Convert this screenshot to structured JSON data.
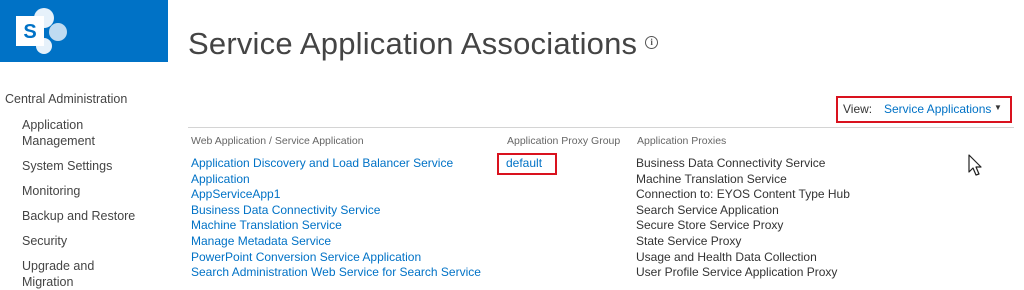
{
  "header": {
    "logo_letter": "S",
    "page_title": "Service Application Associations",
    "info_glyph": "i"
  },
  "leftnav": {
    "root": "Central Administration",
    "items": [
      "Application Management",
      "System Settings",
      "Monitoring",
      "Backup and Restore",
      "Security",
      "Upgrade and Migration"
    ]
  },
  "view": {
    "label": "View:",
    "selected": "Service Applications",
    "caret": "▼"
  },
  "table": {
    "columns": [
      "Web Application / Service Application",
      "Application Proxy Group",
      "Application Proxies"
    ],
    "applications": [
      "Application Discovery and Load Balancer Service",
      "Application",
      "AppServiceApp1",
      "Business Data Connectivity Service",
      "Machine Translation Service",
      "Manage Metadata Service",
      "PowerPoint Conversion Service Application",
      "Search Administration Web Service for Search Service"
    ],
    "proxy_group": "default",
    "proxies": [
      "Business Data Connectivity Service",
      "Machine Translation Service",
      "Connection to: EYOS Content Type Hub",
      "Search Service Application",
      "Secure Store Service Proxy",
      "State Service Proxy",
      "Usage and Health Data Collection",
      "User Profile Service Application Proxy"
    ]
  },
  "colors": {
    "brand": "#0072c6",
    "link": "#0072c6",
    "highlight": "#d9121e",
    "text": "#444444"
  },
  "icons": {
    "logo": "sharepoint-logo-icon",
    "info": "info-icon",
    "caret": "caret-down-icon",
    "cursor": "mouse-pointer-icon"
  }
}
